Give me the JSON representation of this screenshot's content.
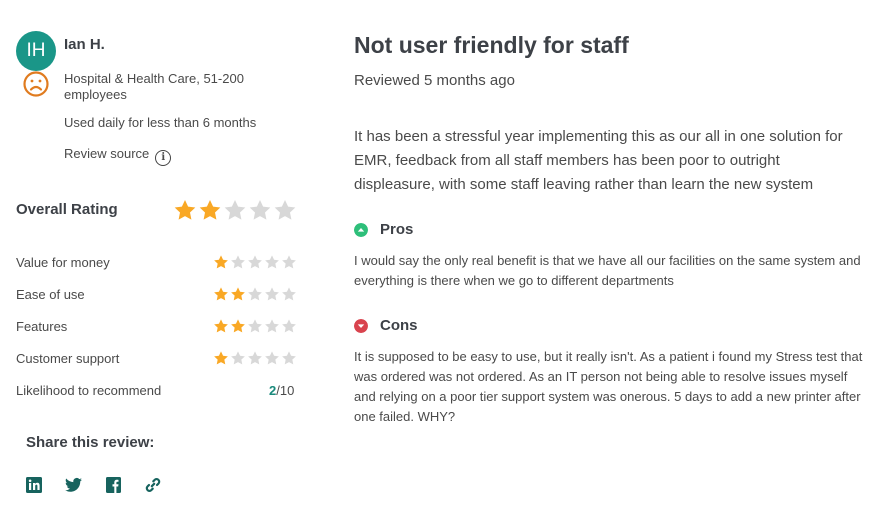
{
  "reviewer": {
    "initials": "IH",
    "name": "Ian H.",
    "company": "Hospital & Health Care, 51-200 employees",
    "usage": "Used daily for less than 6 months",
    "review_source": "Review source",
    "sentiment_icon": "sad-face-icon"
  },
  "ratings": {
    "overall_label": "Overall Rating",
    "overall_value": 2,
    "max": 5,
    "items": [
      {
        "label": "Value for money",
        "value": 1
      },
      {
        "label": "Ease of use",
        "value": 2
      },
      {
        "label": "Features",
        "value": 2
      },
      {
        "label": "Customer support",
        "value": 1
      }
    ],
    "likelihood_label": "Likelihood to recommend",
    "likelihood_value": "2",
    "likelihood_max": "/10"
  },
  "share": {
    "label": "Share this review:",
    "icons": [
      "linkedin-icon",
      "twitter-icon",
      "facebook-icon",
      "link-icon"
    ]
  },
  "review": {
    "title": "Not user friendly for staff",
    "reviewed": "Reviewed 5 months ago",
    "body": "It has been a stressful year implementing this as our all in one solution for EMR, feedback from all staff members has been poor to outright displeasure, with some staff leaving rather than learn the new system",
    "pros_label": "Pros",
    "pros": "I would say the only real benefit is that we have all our facilities on the same system and everything is there when we go to different departments",
    "cons_label": "Cons",
    "cons": "It is supposed to be easy to use, but it really isn't. As a patient i found my Stress test that was ordered was not ordered. As an IT person not being able to resolve issues myself and relying on a poor tier support system was onerous. 5 days to add a new printer after one failed. WHY?"
  },
  "colors": {
    "accent": "#1a9688",
    "star_on": "#f9a825",
    "star_off": "#d8d8d8",
    "pros": "#2ebf7a",
    "cons": "#d9434e",
    "sad": "#e07b1f"
  }
}
